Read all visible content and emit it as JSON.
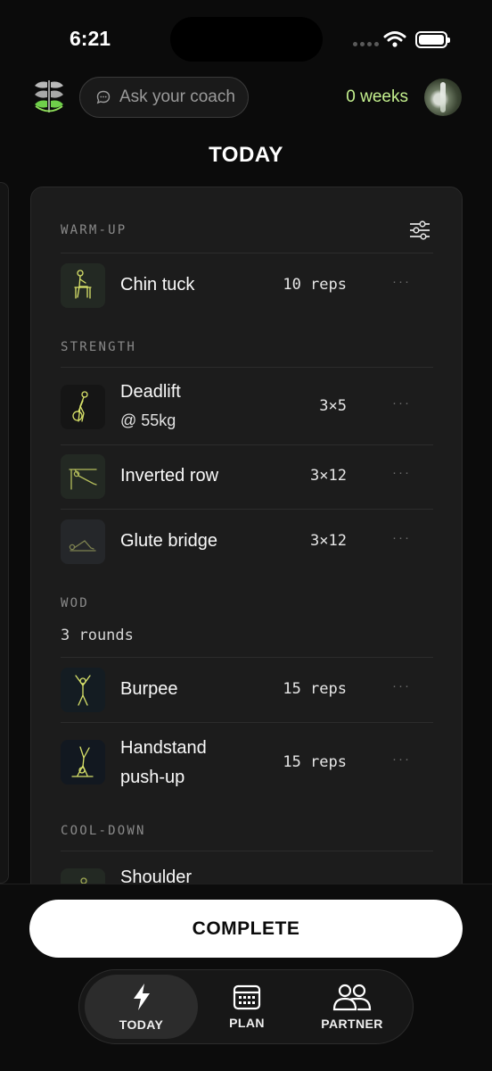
{
  "status": {
    "time": "6:21"
  },
  "header": {
    "coach_placeholder": "Ask your coach",
    "weeks": "0 weeks"
  },
  "page_title": "TODAY",
  "workout": {
    "warmup": {
      "label": "WARM-UP",
      "items": [
        {
          "name": "Chin tuck",
          "qty": "10 reps",
          "icon": "chin-tuck-figure-icon"
        }
      ]
    },
    "strength": {
      "label": "STRENGTH",
      "items": [
        {
          "name": "Deadlift",
          "sub": "@ 55kg",
          "qty": "3×5",
          "icon": "deadlift-figure-icon"
        },
        {
          "name": "Inverted row",
          "qty": "3×12",
          "icon": "inverted-row-figure-icon"
        },
        {
          "name": "Glute bridge",
          "qty": "3×12",
          "icon": "glute-bridge-figure-icon"
        }
      ]
    },
    "wod": {
      "label": "WOD",
      "rounds": "3 rounds",
      "items": [
        {
          "name": "Burpee",
          "qty": "15 reps",
          "icon": "burpee-figure-icon"
        },
        {
          "name_line1": "Handstand",
          "name_line2": "push-up",
          "qty": "15 reps",
          "icon": "handstand-figure-icon"
        }
      ]
    },
    "cooldown": {
      "label": "COOL-DOWN",
      "items": [
        {
          "name": "Shoulder",
          "icon": "shoulder-stretch-figure-icon"
        }
      ]
    },
    "more_glyph": "···"
  },
  "complete_label": "COMPLETE",
  "tabs": [
    {
      "label": "TODAY",
      "icon": "lightning-icon",
      "active": true
    },
    {
      "label": "PLAN",
      "icon": "calendar-icon",
      "active": false
    },
    {
      "label": "PARTNER",
      "icon": "people-icon",
      "active": false
    }
  ],
  "colors": {
    "accent": "#c4f08e",
    "background": "#0b0b0b",
    "card": "#1c1c1c",
    "icon_line": "#d9e36a"
  }
}
